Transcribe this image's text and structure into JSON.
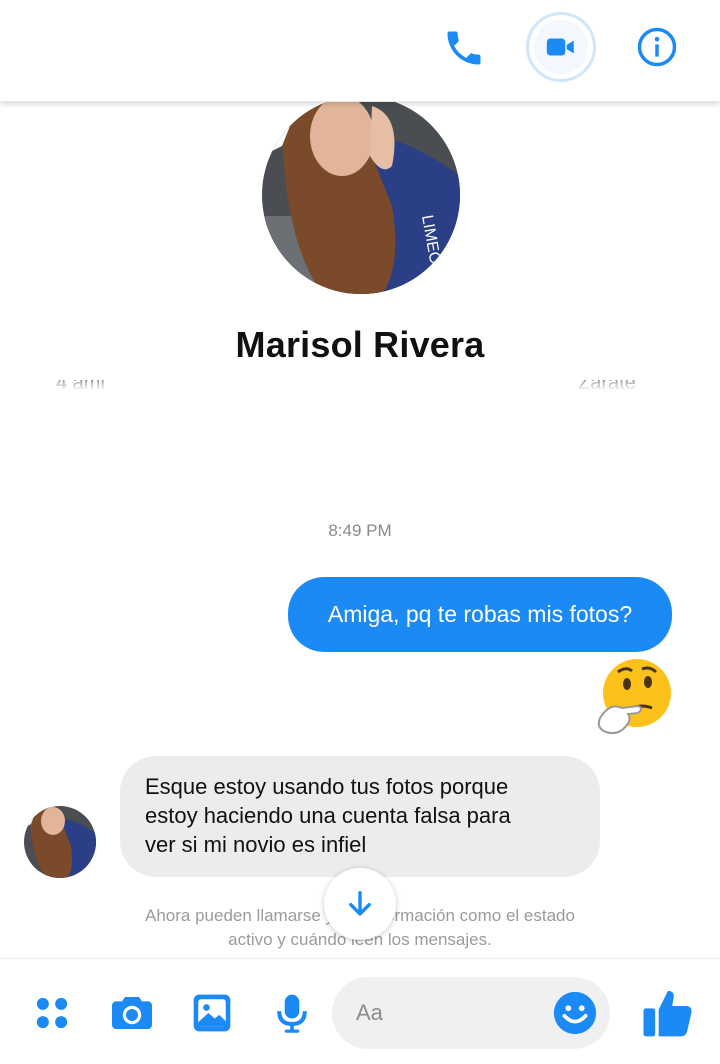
{
  "header": {
    "actions": [
      {
        "name": "call",
        "icon": "phone-icon"
      },
      {
        "name": "video-call",
        "icon": "video-camera-icon"
      },
      {
        "name": "info",
        "icon": "info-icon"
      }
    ]
  },
  "profile": {
    "name": "Marisol Rivera",
    "mutual_left_fragment": "4 ami",
    "mutual_right_fragment": "Zarate"
  },
  "conversation": {
    "timestamp": "8:49 PM",
    "messages": [
      {
        "direction": "outgoing",
        "text": "Amiga, pq te robas mis fotos?"
      },
      {
        "direction": "outgoing",
        "type": "emoji",
        "icon": "thinking-face-icon"
      },
      {
        "direction": "incoming",
        "lines": [
          "Esque estoy usando tus fotos porque",
          "estoy haciendo una cuenta falsa para",
          "ver si mi novio es infiel"
        ]
      }
    ],
    "notice": {
      "line1": "Ahora pueden llamarse y ver información como el estado",
      "line2": "activo y cuándo leen los mensajes."
    }
  },
  "composer": {
    "placeholder": "Aa",
    "tools": [
      "more-icon",
      "camera-icon",
      "gallery-icon",
      "microphone-icon",
      "emoji-icon",
      "thumbs-up-icon"
    ]
  },
  "colors": {
    "accent": "#1b8af5",
    "incoming_bubble": "#ececec",
    "muted_text": "#9b9b9b"
  }
}
